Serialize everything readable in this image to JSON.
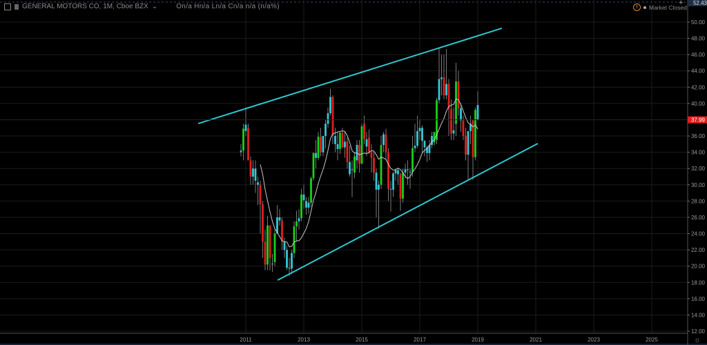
{
  "header": {
    "symbol_title": "GENERAL MOTORS CO, 1M, Cboe BZX",
    "ohlc_readout": "On/a  Hn/a  Ln/a  Cn/a  n/a (n/a%)",
    "market_status": "Market Closed",
    "crosshair_price": "52.43"
  },
  "colors": {
    "background": "#000000",
    "up_strong": "#19d219",
    "up": "#36c8d8",
    "down": "#e0201e",
    "trendline": "#2ec8d0",
    "ma": "#c8c8c8",
    "last_price": "#e0201e",
    "grid": "#1c1c1c"
  },
  "chart_data": {
    "type": "candlestick",
    "title": "GENERAL MOTORS CO, 1M, Cboe BZX",
    "interval": "1M",
    "start": "2010-11",
    "ylim": [
      12,
      52.43
    ],
    "xlim": [
      2007.9,
      2026.6
    ],
    "y_ticks": [
      "50.00",
      "48.00",
      "46.00",
      "44.00",
      "42.00",
      "40.00",
      "38.00",
      "36.00",
      "34.00",
      "32.00",
      "30.00",
      "28.00",
      "26.00",
      "24.00",
      "22.00",
      "20.00",
      "18.00",
      "16.00",
      "14.00",
      "12.00"
    ],
    "x_ticks": [
      "2011",
      "2013",
      "2015",
      "2017",
      "2019",
      "2021",
      "2023",
      "2025"
    ],
    "last_price": "37.99",
    "candles_ohlc_color": [
      [
        34,
        35,
        33.5,
        34.2,
        "c"
      ],
      [
        34.2,
        37.5,
        33,
        36.9,
        "g"
      ],
      [
        36.6,
        39.5,
        36,
        37.4,
        "c"
      ],
      [
        37,
        37.5,
        33,
        33,
        "r"
      ],
      [
        33,
        33.5,
        30,
        31,
        "r"
      ],
      [
        31,
        33,
        30,
        32,
        "c"
      ],
      [
        32,
        33,
        29,
        30.5,
        "c"
      ],
      [
        30.3,
        31,
        27.5,
        30,
        "c"
      ],
      [
        30,
        30.5,
        24,
        27.6,
        "r"
      ],
      [
        27.6,
        28,
        21,
        23,
        "r"
      ],
      [
        23,
        24.5,
        19.5,
        20.2,
        "r"
      ],
      [
        20.2,
        26.2,
        19.5,
        25,
        "g"
      ],
      [
        25,
        25,
        19.5,
        21,
        "r"
      ],
      [
        20.3,
        21.5,
        19.3,
        20.3,
        "c"
      ],
      [
        20.5,
        24.5,
        20,
        24,
        "g"
      ],
      [
        24,
        27.5,
        24,
        26,
        "c"
      ],
      [
        26,
        27,
        25,
        25.6,
        "c"
      ],
      [
        25.6,
        26,
        22,
        23,
        "r"
      ],
      [
        23,
        23.5,
        21,
        22,
        "c"
      ],
      [
        22,
        22.5,
        19.5,
        19.8,
        "c"
      ],
      [
        19.8,
        21,
        18.8,
        19.7,
        "c"
      ],
      [
        19.7,
        22,
        19,
        21.6,
        "c"
      ],
      [
        21.6,
        25.5,
        21,
        24.9,
        "g"
      ],
      [
        24.9,
        26.8,
        23,
        25.5,
        "g"
      ],
      [
        25.5,
        27,
        24.5,
        25.9,
        "c"
      ],
      [
        25.9,
        29.5,
        25.5,
        28.8,
        "g"
      ],
      [
        28.8,
        30,
        27,
        28.1,
        "c"
      ],
      [
        28,
        28.5,
        26.3,
        27.2,
        "c"
      ],
      [
        27.2,
        28.5,
        26.5,
        27.8,
        "c"
      ],
      [
        27.8,
        31,
        27.3,
        30.8,
        "g"
      ],
      [
        30.8,
        34,
        30.5,
        33.9,
        "g"
      ],
      [
        33.9,
        35.5,
        32,
        33.3,
        "c"
      ],
      [
        33.3,
        36.5,
        33,
        35.9,
        "g"
      ],
      [
        35.9,
        37,
        33.5,
        34,
        "r"
      ],
      [
        34,
        36,
        33.5,
        36,
        "c"
      ],
      [
        36,
        38,
        34.5,
        37.5,
        "c"
      ],
      [
        37.5,
        39.5,
        37,
        38.8,
        "c"
      ],
      [
        38.8,
        41.8,
        38.5,
        40.8,
        "c"
      ],
      [
        40.8,
        41,
        35,
        36.1,
        "r"
      ],
      [
        36,
        37,
        34,
        35,
        "c"
      ],
      [
        35,
        36.5,
        33,
        34.4,
        "c"
      ],
      [
        34.4,
        36.5,
        33.8,
        36.4,
        "g"
      ],
      [
        36.4,
        37,
        34.5,
        34.6,
        "r"
      ],
      [
        34.6,
        36.5,
        33.3,
        35.3,
        "c"
      ],
      [
        35.3,
        35.8,
        32,
        32.8,
        "r"
      ],
      [
        32.8,
        34.8,
        31,
        31.3,
        "c"
      ],
      [
        31.9,
        33,
        28.5,
        31.9,
        "c"
      ],
      [
        31.5,
        34,
        30.8,
        33.5,
        "g"
      ],
      [
        33,
        35.5,
        32,
        34.9,
        "c"
      ],
      [
        34.9,
        35.5,
        31.5,
        32.6,
        "r"
      ],
      [
        32.6,
        37.5,
        32.5,
        37.2,
        "g"
      ],
      [
        37.5,
        38.5,
        35,
        35.6,
        "r"
      ],
      [
        35.6,
        36.5,
        33.5,
        34.7,
        "c"
      ],
      [
        35.8,
        36.8,
        33.8,
        34,
        "r"
      ],
      [
        34,
        35,
        31.5,
        33.3,
        "r"
      ],
      [
        33.3,
        34,
        30.5,
        31.5,
        "r"
      ],
      [
        31.5,
        32,
        26,
        29.4,
        "c"
      ],
      [
        29.4,
        30.5,
        24.6,
        30,
        "c"
      ],
      [
        30,
        36,
        29.5,
        34.9,
        "g"
      ],
      [
        34.9,
        36.5,
        34,
        36.2,
        "c"
      ],
      [
        36.2,
        36.9,
        33,
        34,
        "r"
      ],
      [
        34,
        34.5,
        28,
        29.5,
        "r"
      ],
      [
        29.5,
        30.5,
        26.7,
        29.4,
        "c"
      ],
      [
        29.4,
        31.6,
        28.5,
        31.4,
        "c"
      ],
      [
        31.4,
        32,
        30.5,
        31.8,
        "c"
      ],
      [
        31.8,
        32,
        30,
        31.3,
        "c"
      ],
      [
        31.3,
        31.5,
        26.8,
        28.3,
        "r"
      ],
      [
        28.3,
        32,
        27.8,
        31.5,
        "g"
      ],
      [
        31.5,
        32.6,
        30.8,
        31.9,
        "c"
      ],
      [
        31.9,
        33,
        30,
        31.8,
        "c"
      ],
      [
        31.6,
        32,
        29.5,
        31.6,
        "c"
      ],
      [
        31.6,
        36,
        31,
        34.5,
        "g"
      ],
      [
        34.5,
        37.5,
        34,
        34.8,
        "c"
      ],
      [
        34.8,
        38.5,
        34.5,
        36.6,
        "c"
      ],
      [
        36.6,
        38,
        35.5,
        37,
        "c"
      ],
      [
        37,
        37.3,
        34,
        35.4,
        "c"
      ],
      [
        35.4,
        35.5,
        33.5,
        34.6,
        "c"
      ],
      [
        34.6,
        34.8,
        32.8,
        33.9,
        "c"
      ],
      [
        33.9,
        35.5,
        33,
        34.9,
        "c"
      ],
      [
        34.9,
        36.5,
        34.5,
        36,
        "c"
      ],
      [
        35.2,
        36.4,
        34.8,
        36.5,
        "g"
      ],
      [
        35.5,
        40.7,
        35,
        40.4,
        "g"
      ],
      [
        40.4,
        46.8,
        40,
        43,
        "c"
      ],
      [
        43,
        46,
        41,
        43.2,
        "c"
      ],
      [
        43.2,
        46,
        40.5,
        41,
        "r"
      ],
      [
        41,
        46.7,
        40.5,
        42.4,
        "c"
      ],
      [
        42.4,
        43,
        36,
        39.3,
        "r"
      ],
      [
        39.3,
        40.5,
        35.5,
        36.3,
        "r"
      ],
      [
        36.3,
        39.5,
        35.5,
        36.7,
        "c"
      ],
      [
        37.5,
        45,
        36,
        42.7,
        "g"
      ],
      [
        42.7,
        44,
        38.5,
        39.4,
        "r"
      ],
      [
        39.4,
        40,
        36.5,
        37.9,
        "c"
      ],
      [
        37.9,
        38.5,
        35.5,
        36,
        "r"
      ],
      [
        36,
        37,
        33,
        33.7,
        "r"
      ],
      [
        33.7,
        36.5,
        30.6,
        36.6,
        "c"
      ],
      [
        36.6,
        38.5,
        35,
        37.5,
        "c"
      ],
      [
        37.9,
        38,
        30.6,
        33.4,
        "r"
      ],
      [
        33.4,
        39.5,
        33,
        39.2,
        "g"
      ],
      [
        39.8,
        41.5,
        37.9,
        38,
        "c"
      ]
    ],
    "moving_average_period": 9,
    "trendlines": [
      {
        "name": "upper-channel",
        "from": [
          2009.36,
          37.53
        ],
        "to": [
          2019.83,
          49.24
        ]
      },
      {
        "name": "lower-channel",
        "from": [
          2012.1,
          18.28
        ],
        "to": [
          2021.07,
          35.07
        ]
      }
    ]
  }
}
